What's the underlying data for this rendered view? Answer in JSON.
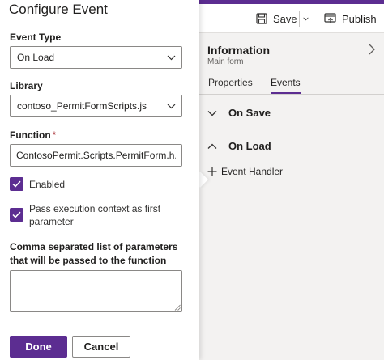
{
  "colors": {
    "accent": "#5c2d91",
    "background": "#f3f2f1",
    "panel": "#ffffff",
    "border": "#8a8886"
  },
  "designer": {
    "commandbar": {
      "save_label": "Save",
      "publish_label": "Publish",
      "save_icon": "save-icon",
      "publish_icon": "publish-icon"
    },
    "panel": {
      "title": "Information",
      "subtitle": "Main form"
    },
    "tabs": [
      {
        "label": "Properties",
        "selected": false
      },
      {
        "label": "Events",
        "selected": true
      }
    ],
    "sections": [
      {
        "label": "On Save",
        "expanded": false
      },
      {
        "label": "On Load",
        "expanded": true
      }
    ],
    "add_handler_label": "Event Handler"
  },
  "dialog": {
    "title": "Configure Event",
    "event_type": {
      "label": "Event Type",
      "value": "On Load"
    },
    "library": {
      "label": "Library",
      "value": "contoso_PermitFormScripts.js"
    },
    "function": {
      "label": "Function",
      "required_mark": "*",
      "value": "ContosoPermit.Scripts.PermitForm.h..."
    },
    "enabled": {
      "label": "Enabled",
      "checked": true
    },
    "pass_context": {
      "label": "Pass execution context as first parameter",
      "checked": true
    },
    "parameters": {
      "label": "Comma separated list of parameters that will be passed to the function",
      "value": ""
    },
    "done_label": "Done",
    "cancel_label": "Cancel"
  }
}
